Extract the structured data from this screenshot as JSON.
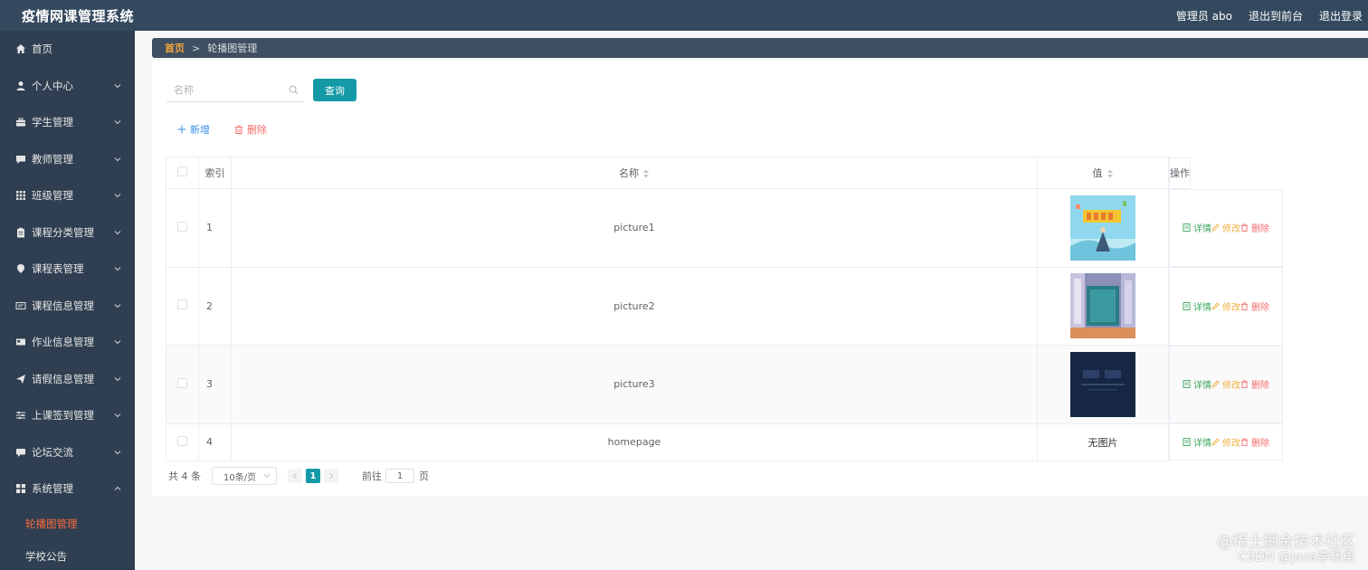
{
  "header": {
    "title": "疫情网课管理系统",
    "user_label": "管理员 abo",
    "front_link": "退出到前台",
    "logout_link": "退出登录"
  },
  "sidebar": {
    "items": [
      {
        "label": "首页",
        "icon": "home-icon",
        "has_chevron": false
      },
      {
        "label": "个人中心",
        "icon": "user-icon",
        "has_chevron": true
      },
      {
        "label": "学生管理",
        "icon": "briefcase-icon",
        "has_chevron": true
      },
      {
        "label": "教师管理",
        "icon": "chat-icon",
        "has_chevron": true
      },
      {
        "label": "班级管理",
        "icon": "grid-icon",
        "has_chevron": true
      },
      {
        "label": "课程分类管理",
        "icon": "clipboard-icon",
        "has_chevron": true
      },
      {
        "label": "课程表管理",
        "icon": "pin-icon",
        "has_chevron": true
      },
      {
        "label": "课程信息管理",
        "icon": "message-icon",
        "has_chevron": true
      },
      {
        "label": "作业信息管理",
        "icon": "card-icon",
        "has_chevron": true
      },
      {
        "label": "请假信息管理",
        "icon": "send-icon",
        "has_chevron": true
      },
      {
        "label": "上课签到管理",
        "icon": "sliders-icon",
        "has_chevron": true
      },
      {
        "label": "论坛交流",
        "icon": "comment-icon",
        "has_chevron": true
      },
      {
        "label": "系统管理",
        "icon": "apps-icon",
        "has_chevron": true,
        "expanded": true
      }
    ],
    "sub_items": [
      {
        "label": "轮播图管理",
        "active": true
      },
      {
        "label": "学校公告",
        "active": false
      }
    ]
  },
  "breadcrumb": {
    "home": "首页",
    "separator": ">",
    "current": "轮播图管理"
  },
  "search": {
    "placeholder": "名称",
    "value": "",
    "button_label": "查询"
  },
  "actions": {
    "add_label": "新增",
    "delete_label": "删除"
  },
  "table": {
    "headers": {
      "index": "索引",
      "name": "名称",
      "value": "值",
      "operations": "操作"
    },
    "rows": [
      {
        "index": "1",
        "name": "picture1",
        "value_type": "image",
        "image": "light-blue-illustration"
      },
      {
        "index": "2",
        "name": "picture2",
        "value_type": "image",
        "image": "blurred-teal-hallway"
      },
      {
        "index": "3",
        "name": "picture3",
        "value_type": "image",
        "image": "dark-navy-banner"
      },
      {
        "index": "4",
        "name": "homepage",
        "value_type": "text",
        "value_text": "无图片"
      }
    ],
    "op_labels": {
      "detail": "详情",
      "edit": "修改",
      "delete": "删除"
    }
  },
  "pagination": {
    "total_text": "共 4 条",
    "page_size": "10条/页",
    "current_page": "1",
    "goto_label": "前往",
    "goto_value": "1",
    "page_suffix": "页"
  },
  "watermark": {
    "line1": "@稀土掘金技术社区",
    "line2": "CSDN @java李杨勇"
  },
  "colors": {
    "topbar": "#34495e",
    "sidebar": "#2f3f51",
    "accent": "#149aa6",
    "active_menu": "#ff6a3a",
    "detail": "#3aa55c",
    "edit": "#f0b042",
    "delete": "#f56c6c"
  }
}
